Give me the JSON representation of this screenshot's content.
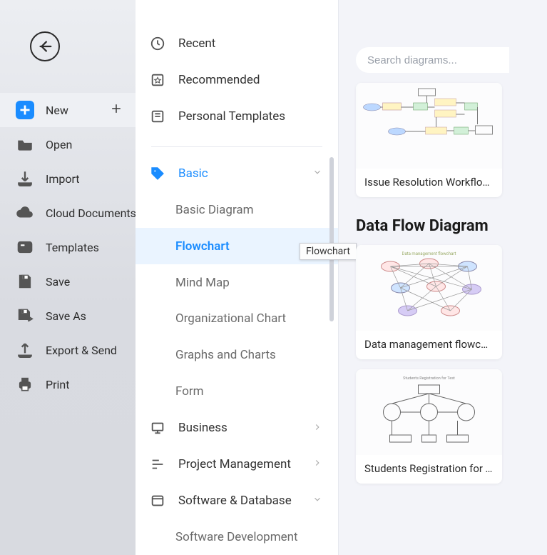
{
  "sidebar": {
    "items": [
      {
        "id": "new",
        "label": "New"
      },
      {
        "id": "open",
        "label": "Open"
      },
      {
        "id": "import",
        "label": "Import"
      },
      {
        "id": "cloud",
        "label": "Cloud Documents"
      },
      {
        "id": "templates",
        "label": "Templates"
      },
      {
        "id": "save",
        "label": "Save"
      },
      {
        "id": "saveas",
        "label": "Save As"
      },
      {
        "id": "export",
        "label": "Export & Send"
      },
      {
        "id": "print",
        "label": "Print"
      }
    ]
  },
  "categories": {
    "top": [
      {
        "id": "recent",
        "label": "Recent"
      },
      {
        "id": "recommended",
        "label": "Recommended"
      },
      {
        "id": "personal",
        "label": "Personal Templates"
      }
    ],
    "basic": {
      "label": "Basic",
      "children": [
        {
          "id": "basic-diagram",
          "label": "Basic Diagram"
        },
        {
          "id": "flowchart",
          "label": "Flowchart"
        },
        {
          "id": "mindmap",
          "label": "Mind Map"
        },
        {
          "id": "org",
          "label": "Organizational Chart"
        },
        {
          "id": "graphs",
          "label": "Graphs and Charts"
        },
        {
          "id": "form",
          "label": "Form"
        }
      ]
    },
    "more": [
      {
        "id": "business",
        "label": "Business"
      },
      {
        "id": "pm",
        "label": "Project Management"
      },
      {
        "id": "swdb",
        "label": "Software & Database"
      }
    ],
    "swdb_children": [
      {
        "id": "swdev",
        "label": "Software Development"
      }
    ]
  },
  "tooltip": "Flowchart",
  "search": {
    "placeholder": "Search diagrams..."
  },
  "section_title_top_card": "Issue Resolution Workflow ...",
  "section_title_dfd": "Data Flow Diagram",
  "cards": {
    "dfd1": "Data management flowchart",
    "dfd2": "Students Registration for T..."
  }
}
